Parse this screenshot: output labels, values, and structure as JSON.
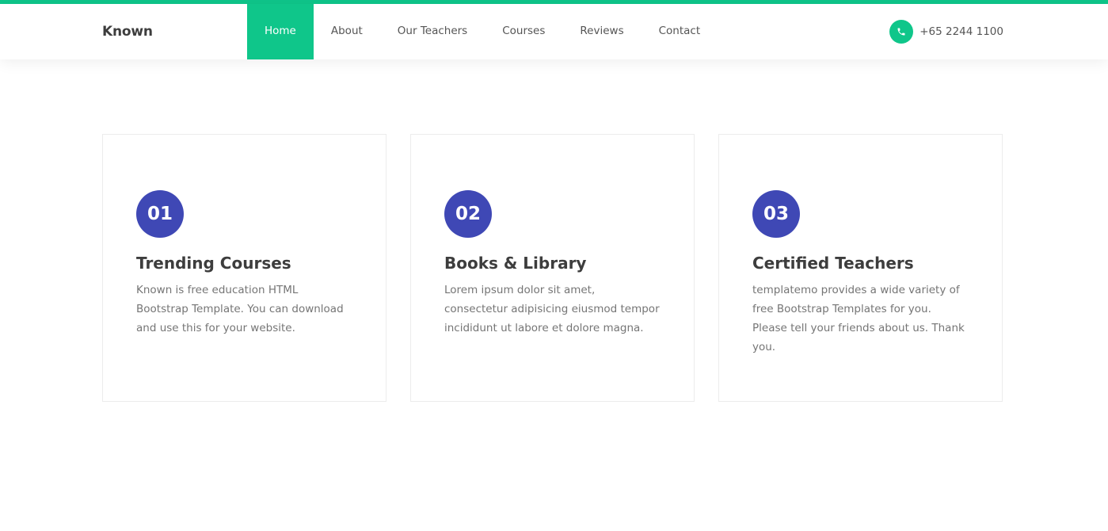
{
  "brand": "Known",
  "nav": {
    "items": [
      {
        "label": "Home",
        "active": true
      },
      {
        "label": "About",
        "active": false
      },
      {
        "label": "Our Teachers",
        "active": false
      },
      {
        "label": "Courses",
        "active": false
      },
      {
        "label": "Reviews",
        "active": false
      },
      {
        "label": "Contact",
        "active": false
      }
    ]
  },
  "contact": {
    "phone": "+65 2244 1100",
    "icon": "phone-icon"
  },
  "features": [
    {
      "number": "01",
      "title": "Trending Courses",
      "text": "Known is free education HTML Bootstrap Template. You can download and use this for your website."
    },
    {
      "number": "02",
      "title": "Books & Library",
      "text": "Lorem ipsum dolor sit amet, consectetur adipisicing eiusmod tempor incididunt ut labore et dolore magna."
    },
    {
      "number": "03",
      "title": "Certified Teachers",
      "text": "templatemo provides a wide variety of free Bootstrap Templates for you. Please tell your friends about us. Thank you."
    }
  ],
  "colors": {
    "accent": "#0fc68a",
    "badge": "#3f48b5",
    "heading": "#3d3d3d",
    "body_text": "#757575"
  }
}
